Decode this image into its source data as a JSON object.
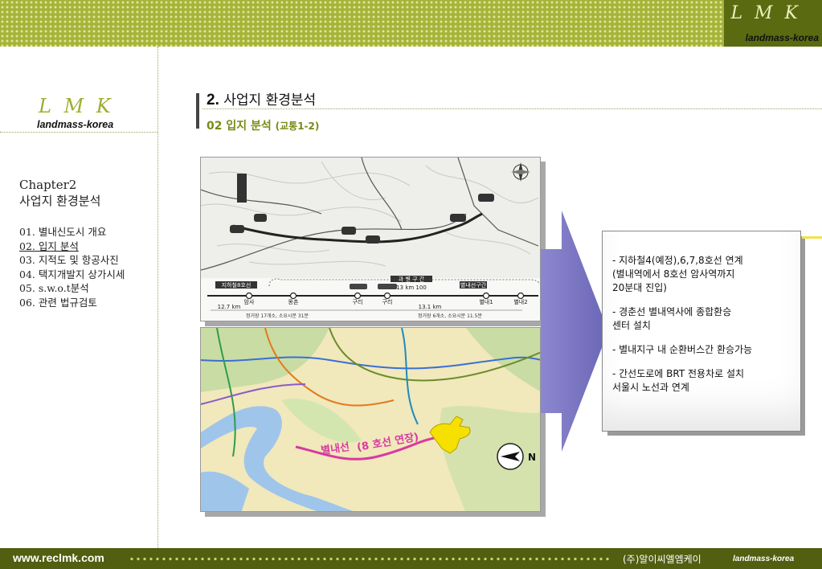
{
  "brand": {
    "logo": "L M K",
    "tagline": "landmass-korea"
  },
  "sidebar": {
    "chapter": "Chapter2",
    "chapter_title": "사업지 환경분석",
    "items": [
      {
        "label": "01. 별내신도시 개요"
      },
      {
        "label": "02. 입지 분석"
      },
      {
        "label": "03. 지적도 및 항공사진"
      },
      {
        "label": "04. 택지개발지 상가시세"
      },
      {
        "label": "05. s.w.o.t분석"
      },
      {
        "label": "06. 관련 법규검토"
      }
    ]
  },
  "header": {
    "number": "2.",
    "title": "사업지 환경분석",
    "sub_number": "02",
    "sub_title": "입지 분석",
    "sub_note": "(교통1-2)"
  },
  "map1": {
    "section_label": "과 별 구 간",
    "section_length": "13 km 100",
    "left_section_label": "지하철8호선",
    "right_section_label": "별내선구간",
    "distance_left": "12.7 km",
    "distance_right": "13.1 km",
    "stations": [
      "암사",
      "몽촌",
      "구리",
      "구리",
      "별내1",
      "별내2"
    ],
    "caption_left": "정거장 17개소, 소요시분 31분",
    "caption_right": "정거장 6개소, 소요시분 11.5분"
  },
  "map2": {
    "line_label": "별내선",
    "line_note": "(8 호선 연장)",
    "compass": "N"
  },
  "callout": {
    "items": [
      {
        "lines": [
          "- 지하철4(예정),6,7,8호선 연계",
          "  (별내역에서 8호선 암사역까지",
          "   20분대 진입)"
        ]
      },
      {
        "lines": [
          "- 경춘선 별내역사에 종합환승",
          "   센터 설치"
        ]
      },
      {
        "lines": [
          "- 별내지구 내 순환버스간 환승가능"
        ]
      },
      {
        "lines": [
          "- 간선도로에 BRT 전용차로 설치",
          "   서울시 노선과 연계"
        ]
      }
    ]
  },
  "footer": {
    "url": "www.reclmk.com",
    "company": "(주)알이씨엘엠케이",
    "brand": "landmass-korea"
  },
  "colors": {
    "accent": "#a6b43a",
    "dark_olive": "#525e10",
    "arrow": "#7f7ac4",
    "line_pink": "#d83aa0",
    "site_yellow": "#f5e000"
  }
}
